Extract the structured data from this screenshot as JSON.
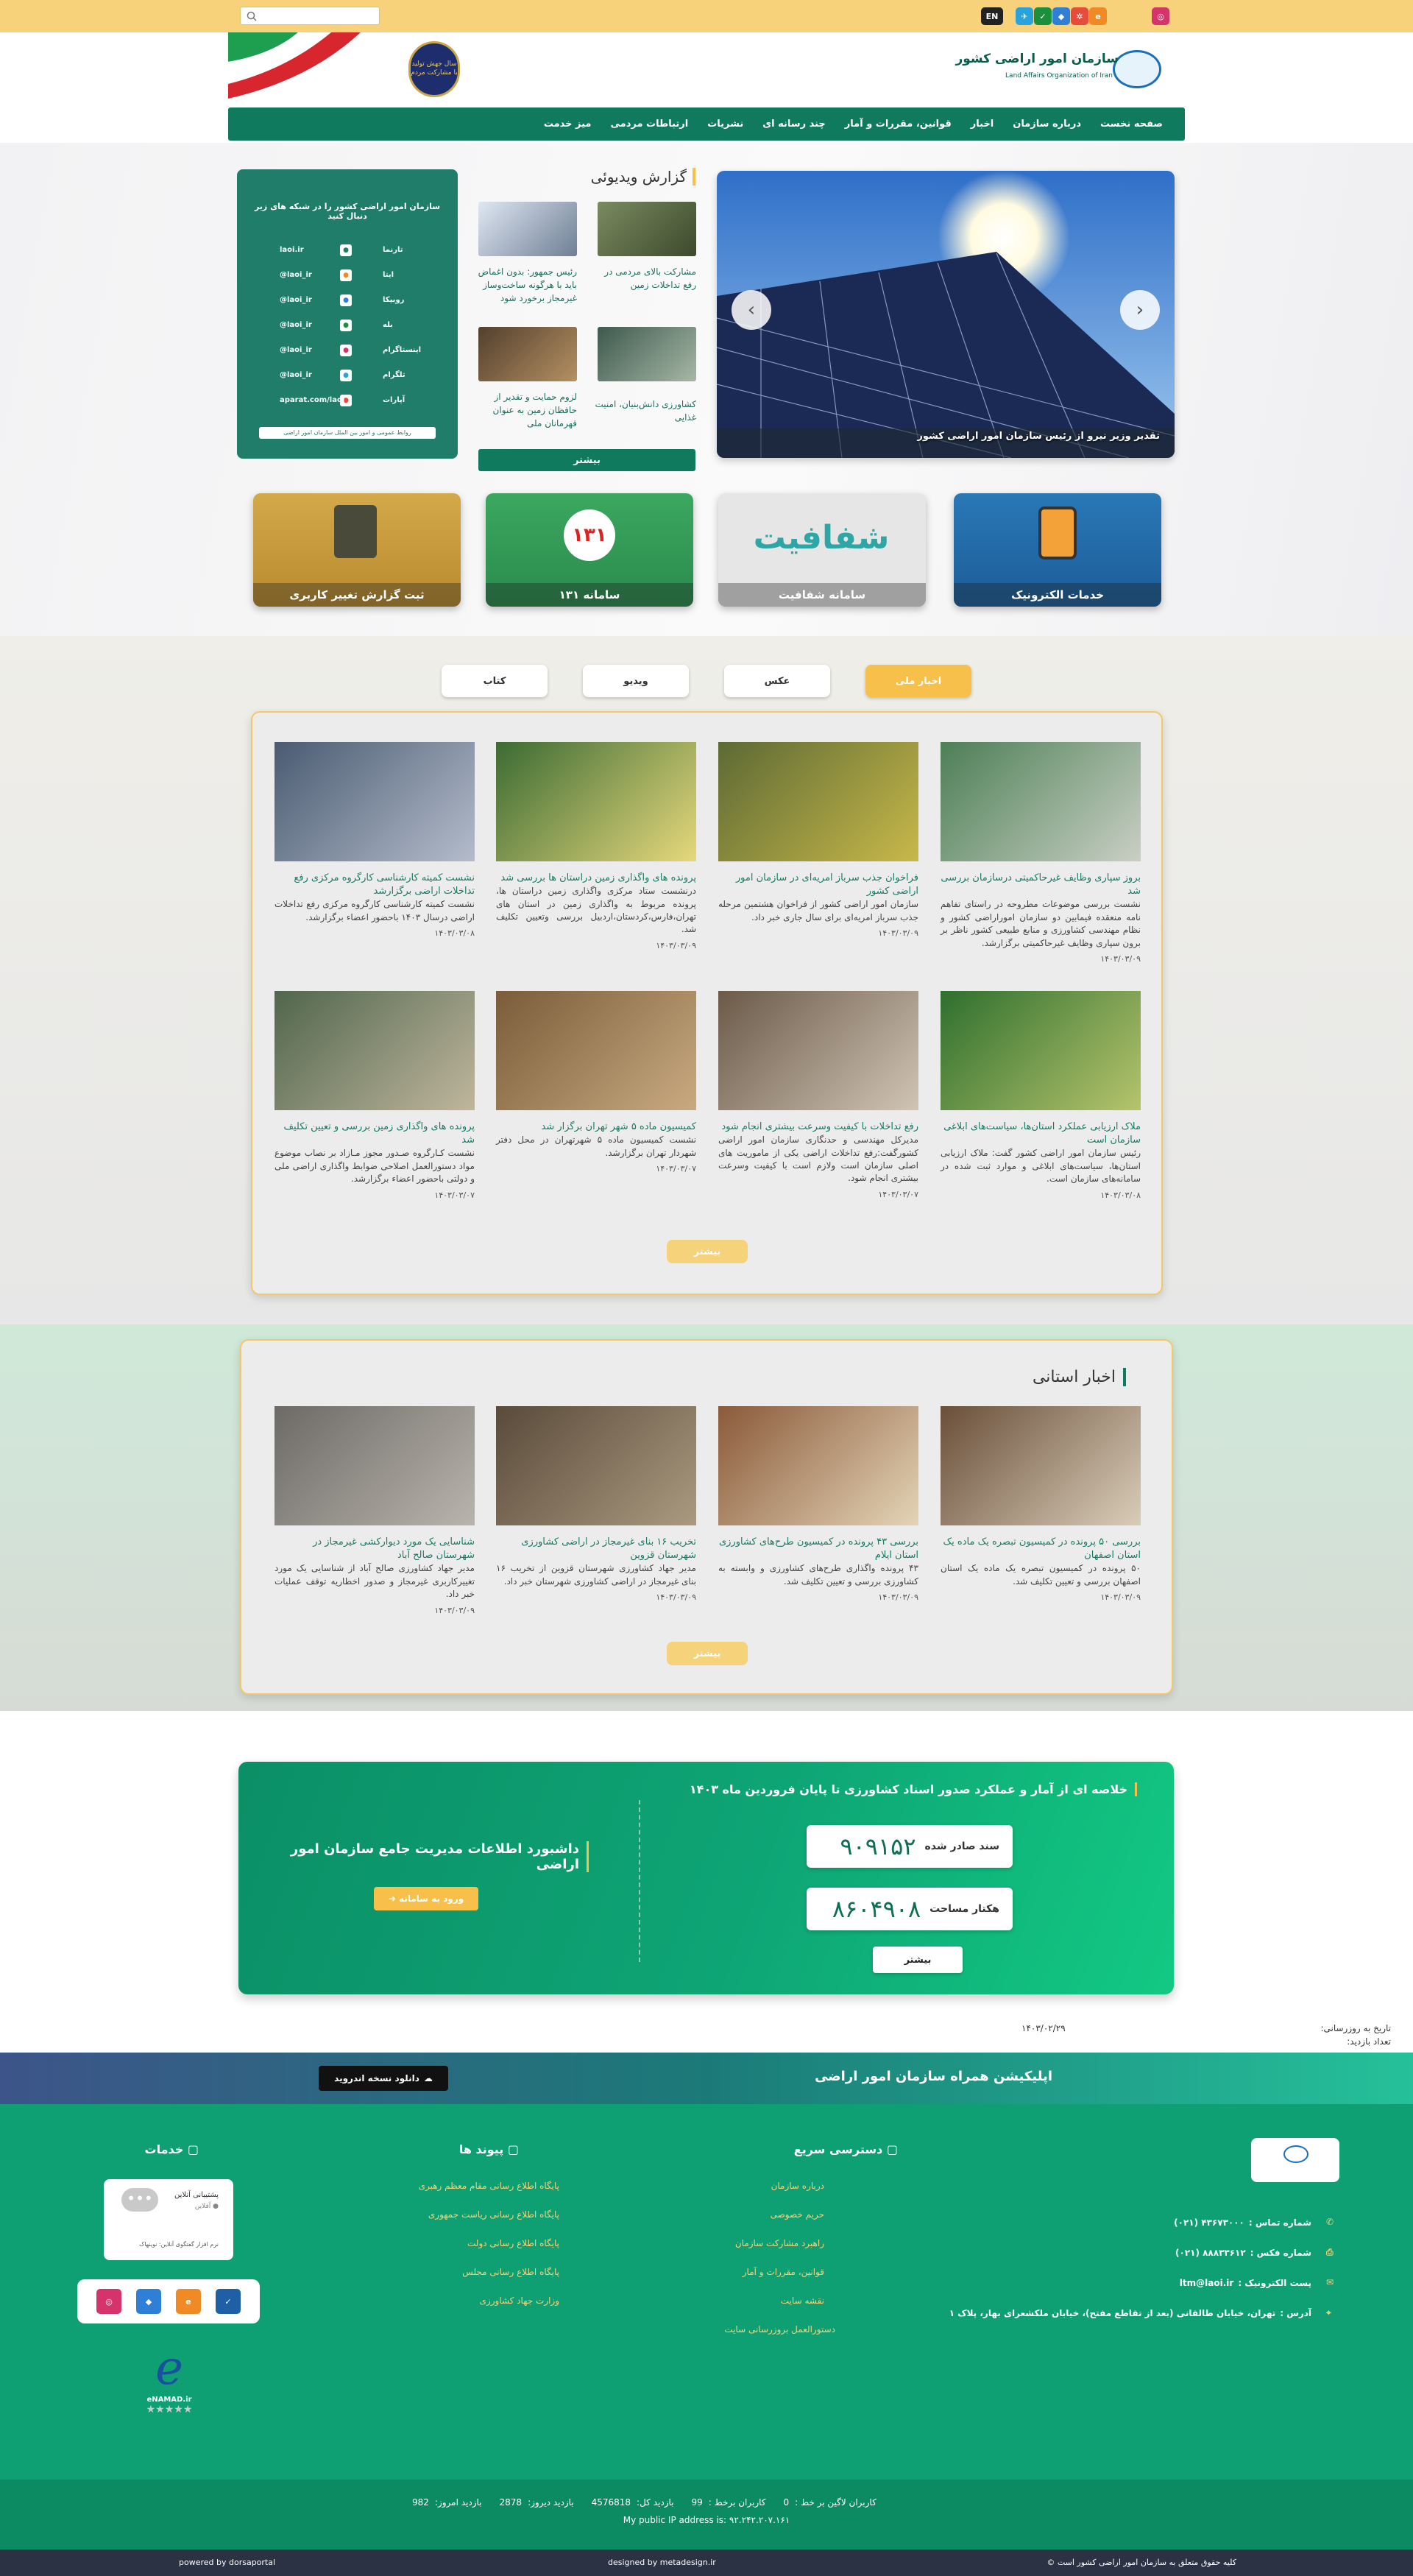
{
  "topbar": {
    "lang": "EN",
    "search_placeholder": ""
  },
  "header": {
    "org_title": "سازمان امور اراضی کشور",
    "org_sub": "Land Affairs Organization of Iran",
    "seal_text": "سال جهش تولید با مشارکت مردم"
  },
  "nav": [
    "صفحه نخست",
    "درباره سازمان",
    "اخبار",
    "قوانین، مقررات و آمار",
    "چند رسانه ای",
    "نشریات",
    "ارتباطات مردمی",
    "میز خدمت"
  ],
  "slider": {
    "caption": "تقدیر وزیر نیرو از رئیس سازمان امور اراضی کشور"
  },
  "video": {
    "title": "گزارش ویدیوئی",
    "items": [
      {
        "text": "مشارکت بالای مردمی در رفع تداخلات زمین"
      },
      {
        "text": "رئیس جمهور: بدون اغماض باید با هرگونه ساخت‌وساز غیرمجاز برخورد شود"
      },
      {
        "text": "کشاورزی دانش‌بنیان، امنیت غذایی"
      },
      {
        "text": "لزوم حمایت و تقدیر از حافظان زمین به عنوان قهرمانان ملی"
      }
    ],
    "more": "بیشتر"
  },
  "social_panel": {
    "title": "سازمان امور اراضی کشور را در شبکه های زیر دنبال کنید",
    "rows": [
      {
        "name": "تارنما",
        "handle": "laoi.ir"
      },
      {
        "name": "ایتا",
        "handle": "@laoi_ir"
      },
      {
        "name": "روبیکا",
        "handle": "@laoi_ir"
      },
      {
        "name": "بله",
        "handle": "@laoi_ir"
      },
      {
        "name": "اینستاگرام",
        "handle": "@laoi_ir"
      },
      {
        "name": "تلگرام",
        "handle": "@laoi_ir"
      },
      {
        "name": "آپارات",
        "handle": "aparat.com/laoi"
      }
    ],
    "footer": "روابط عمومی و امور بین الملل سازمان امور اراضی"
  },
  "tiles": [
    {
      "label": "خدمات الکترونیک"
    },
    {
      "label": "سامانه شفافیت"
    },
    {
      "label": "سامانه ۱۳۱"
    },
    {
      "label": "ثبت گزارش تغییر کاربری"
    }
  ],
  "news_tabs": [
    "اخبار ملی",
    "عکس",
    "ویدیو",
    "کتاب"
  ],
  "news": [
    {
      "title": "بروز سپاری وظایف غیرحاکمیتی درسازمان بررسی شد",
      "summary": "نشست بررسی موضوعات مطروحه در راستای تفاهم نامه منعقده فیمابین دو سازمان اموراراضی کشور و نظام مهندسی کشاورزی و منابع طبیعی کشور ناظر بر برون سپاری وظایف غیرحاکمیتی برگزارشد.",
      "date": "۱۴۰۳/۰۳/۰۹"
    },
    {
      "title": "فراخوان جذب سرباز امریه‌ای در سازمان امور اراضی کشور",
      "summary": "سازمان امور اراضی کشور از فراخوان هشتمین مرحله جذب سرباز امریه‌ای برای سال جاری خبر داد.",
      "date": "۱۴۰۳/۰۳/۰۹"
    },
    {
      "title": "پرونده های واگذاری زمین دراستان ها بررسی شد",
      "summary": "درنشست ستاد مرکزی واگذاری زمین دراستان ها، پرونده مربوط به واگذاری زمین در استان های تهران،فارس،کردستان،اردبیل بررسی وتعیین تکلیف شد.",
      "date": "۱۴۰۳/۰۳/۰۹"
    },
    {
      "title": "نشست کمیته کارشناسی کارگروه مرکزی رفع تداخلات اراضی برگزارشد",
      "summary": "نشست کمیته کارشناسی کارگروه مرکزی رفع تداخلات اراضی درسال ۱۴۰۳ باحضور اعضاء برگزارشد.",
      "date": "۱۴۰۳/۰۳/۰۸"
    },
    {
      "title": "ملاک ارزیابی عملکرد استان‌ها، سیاست‌های ابلاغی سازمان است",
      "summary": "رئیس سازمان امور اراضی کشور گفت: ملاک ارزیابی استان‌ها، سیاست‌های ابلاغی و موارد ثبت شده در سامانه‌های سازمان است.",
      "date": "۱۴۰۳/۰۳/۰۸"
    },
    {
      "title": "رفع تداخلات با کیفیت وسرعت بیشتری انجام شود",
      "summary": "مدیرکل مهندسی و حدنگاری سازمان امور اراضی کشورگفت:رفع تداخلات اراضی یکی از ماموریت های اصلی سازمان است ولازم است با کیفیت وسرعت بیشتری انجام شود.",
      "date": "۱۴۰۳/۰۳/۰۷"
    },
    {
      "title": "کمیسیون ماده ۵ شهر تهران برگزار شد",
      "summary": "نشست کمیسیون ماده ۵ شهرتهران در محل دفتر شهردار تهران برگزارشد.",
      "date": "۱۴۰۳/۰۳/۰۷"
    },
    {
      "title": "پرونده های واگذاری زمین بررسی و تعیین تکلیف شد",
      "summary": "نشست کـارگروه صـدور مجوز مـازاد بر نصاب موضوع مواد دستورالعمل اصلاحی ضوابط واگذاری اراضی ملی و دولتی باحضور اعضاء برگزارشد.",
      "date": "۱۴۰۳/۰۳/۰۷"
    }
  ],
  "news_more": "بیشتر",
  "provincial": {
    "title": "اخبار استانی",
    "items": [
      {
        "title": "بررسی ۵۰ پرونده در کمیسیون تبصره یک ماده یک استان اصفهان",
        "summary": "۵۰ پرونده در کمیسیون تبصره یک ماده یک استان اصفهان بررسی و تعیین تکلیف شد.",
        "date": "۱۴۰۳/۰۳/۰۹"
      },
      {
        "title": "بررسی ۴۳ پرونده در کمیسیون طرح‌های کشاورزی استان ایلام",
        "summary": "۴۳ پرونده واگذاری طرح‌های کشاورزی و وابسته به کشاورزی بررسی و تعیین تکلیف شد.",
        "date": "۱۴۰۳/۰۳/۰۹"
      },
      {
        "title": "تخریب ۱۶ بنای غیرمجاز در اراضی کشاورزی شهرستان قزوین",
        "summary": "مدیر جهاد کشاورزی شهرستان قزوین از تخریب ۱۶ بنای غیرمجاز در اراضی کشاورزی شهرستان خبر داد.",
        "date": "۱۴۰۳/۰۳/۰۹"
      },
      {
        "title": "شناسایی یک مورد دیوارکشی غیرمجاز در شهرستان صالح آباد",
        "summary": "مدیر جهاد کشاورزی صالح آباد از شناسایی یک مورد تغییرکاربری غیرمجاز و صدور اخطاریه توقف عملیات خبر داد.",
        "date": "۱۴۰۳/۰۳/۰۹"
      }
    ],
    "more": "بیشتر"
  },
  "stats": {
    "title": "خلاصه ای از آمار و عملکرد صدور اسناد کشاورزی تا پایان فروردین ماه ۱۴۰۳",
    "items": [
      {
        "value": "۹۰۹۱۵۲",
        "label": "سند صادر شده"
      },
      {
        "value": "۸۶۰۴۹۰۸",
        "label": "هکتار مساحت"
      }
    ],
    "more": "بیشتر",
    "dashboard_title": "داشبورد اطلاعات مدیریت جامع سازمان امور اراضی",
    "login": "ورود به سامانه"
  },
  "update": {
    "label": "تاریخ به روزرسانی:",
    "date": "۱۴۰۳/۰۲/۲۹",
    "visits_label": "تعداد بازدید:"
  },
  "app": {
    "title": "اپلیکیشن همراه سازمان امور اراضی",
    "download": "دانلود نسخه اندروید"
  },
  "footer": {
    "services_title": "خدمات",
    "links_title": "پیوند ها",
    "links": [
      "پایگاه اطلاع رسانی مقام معظم رهبری",
      "پایگاه اطلاع رسانی ریاست جمهوری",
      "پایگاه اطلاع رسانی دولت",
      "پایگاه اطلاع رسانی مجلس",
      "وزارت جهاد کشاورزی"
    ],
    "quick_title": "دسترسی سریع",
    "quick": [
      "درباره سازمان",
      "حریم خصوصی",
      "راهبرد مشارکت سازمان",
      "قوانین، مقررات و آمار",
      "نقشه سایت",
      "دستورالعمل بروزرسانی سایت"
    ],
    "support_title": "پشتیبانی آنلاین",
    "support_status": "● آفلاین",
    "support_note": "نرم افزار گفتگوی آنلاین: نوینهاک",
    "enamad": "eNAMAD.ir",
    "contact": [
      {
        "label": "شماره تماس :",
        "value": "۴۳۶۷۳۰۰۰ (۰۲۱)"
      },
      {
        "label": "شماره فکس :",
        "value": "۸۸۸۳۳۶۱۲ (۰۲۱)"
      },
      {
        "label": "پست الکترونیک :",
        "value": "ltm@laoi.ir"
      },
      {
        "label": "آدرس :",
        "value": "تهران، خیابان طالقانی (بعد از تقاطع مفتح)، خیابان ملکشعرای بهار، پلاک ۱"
      }
    ],
    "counter": [
      {
        "label": "بازدید امروز:",
        "value": "982"
      },
      {
        "label": "بازدید دیروز:",
        "value": "2878"
      },
      {
        "label": "بازدید کل:",
        "value": "4576818"
      },
      {
        "label": "کاربران برخط :",
        "value": "99"
      },
      {
        "label": "کاربران لاگین بر خط :",
        "value": "0"
      }
    ],
    "ip": "My public IP address is: ۹۲.۲۴۲.۲۰۷.۱۶۱",
    "copyright": "کلیه حقوق متعلق به سازمان امور اراضی کشور است ©",
    "designed": "designed by metadesign.ir",
    "powered": "powered by dorsaportal"
  },
  "colors": {
    "brand": "#0f7a5d",
    "accent": "#f6c04b",
    "topbar": "#f7d27b"
  }
}
